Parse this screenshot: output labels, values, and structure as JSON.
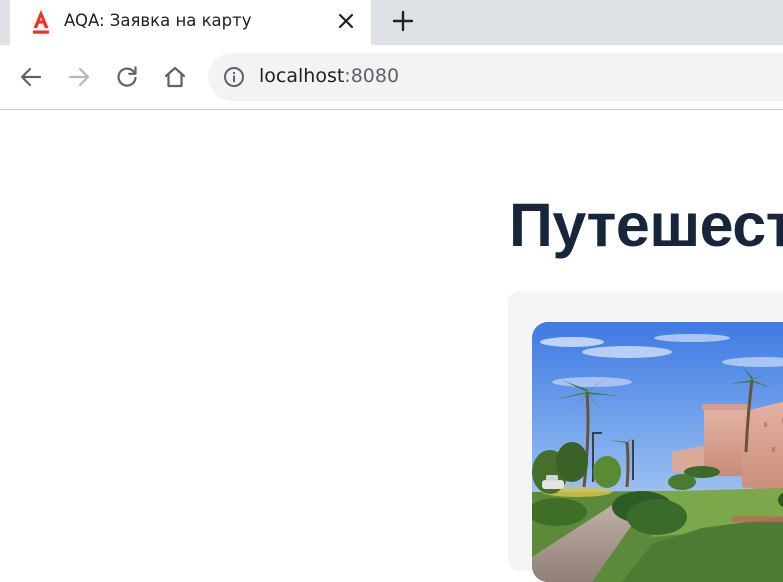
{
  "browser": {
    "tab": {
      "title": "AQA: Заявка на карту",
      "favicon": "alfa-bank-logo",
      "close_icon": "close-icon"
    },
    "new_tab_icon": "plus-icon",
    "toolbar": {
      "back_icon": "arrow-left-icon",
      "forward_icon": "arrow-right-icon",
      "reload_icon": "reload-icon",
      "home_icon": "home-icon"
    },
    "address_bar": {
      "info_icon": "info-icon",
      "host": "localhost",
      "port": ":8080"
    }
  },
  "page": {
    "heading": "Путешест",
    "card": {
      "image": "marrakech-city-walls-palm-trees-photo"
    }
  },
  "colors": {
    "tabbar_bg": "#dee1e6",
    "omnibox_bg": "#f1f3f4",
    "heading_color": "#17263b",
    "alfa_red": "#ef3124",
    "card_bg": "#f4f5f7"
  }
}
